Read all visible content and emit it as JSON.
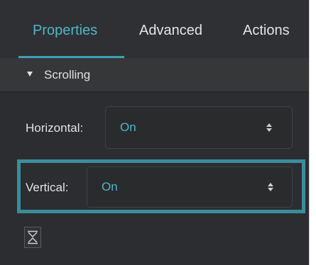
{
  "tabs": [
    {
      "label": "Properties",
      "active": true
    },
    {
      "label": "Advanced",
      "active": false
    },
    {
      "label": "Actions",
      "active": false
    }
  ],
  "section": {
    "label": "Scrolling",
    "expanded": true,
    "toggle_icon": "triangle-down-icon"
  },
  "fields": {
    "horizontal": {
      "label": "Horizontal:",
      "value": "On"
    },
    "vertical": {
      "label": "Vertical:",
      "value": "On",
      "highlighted": true
    }
  },
  "collapse_button": {
    "icon": "collapse-arrows-icon"
  },
  "colors": {
    "accent": "#4fb6c8",
    "highlight": "#3a8e9c",
    "panel": "#2c2d30",
    "section": "#363739"
  }
}
